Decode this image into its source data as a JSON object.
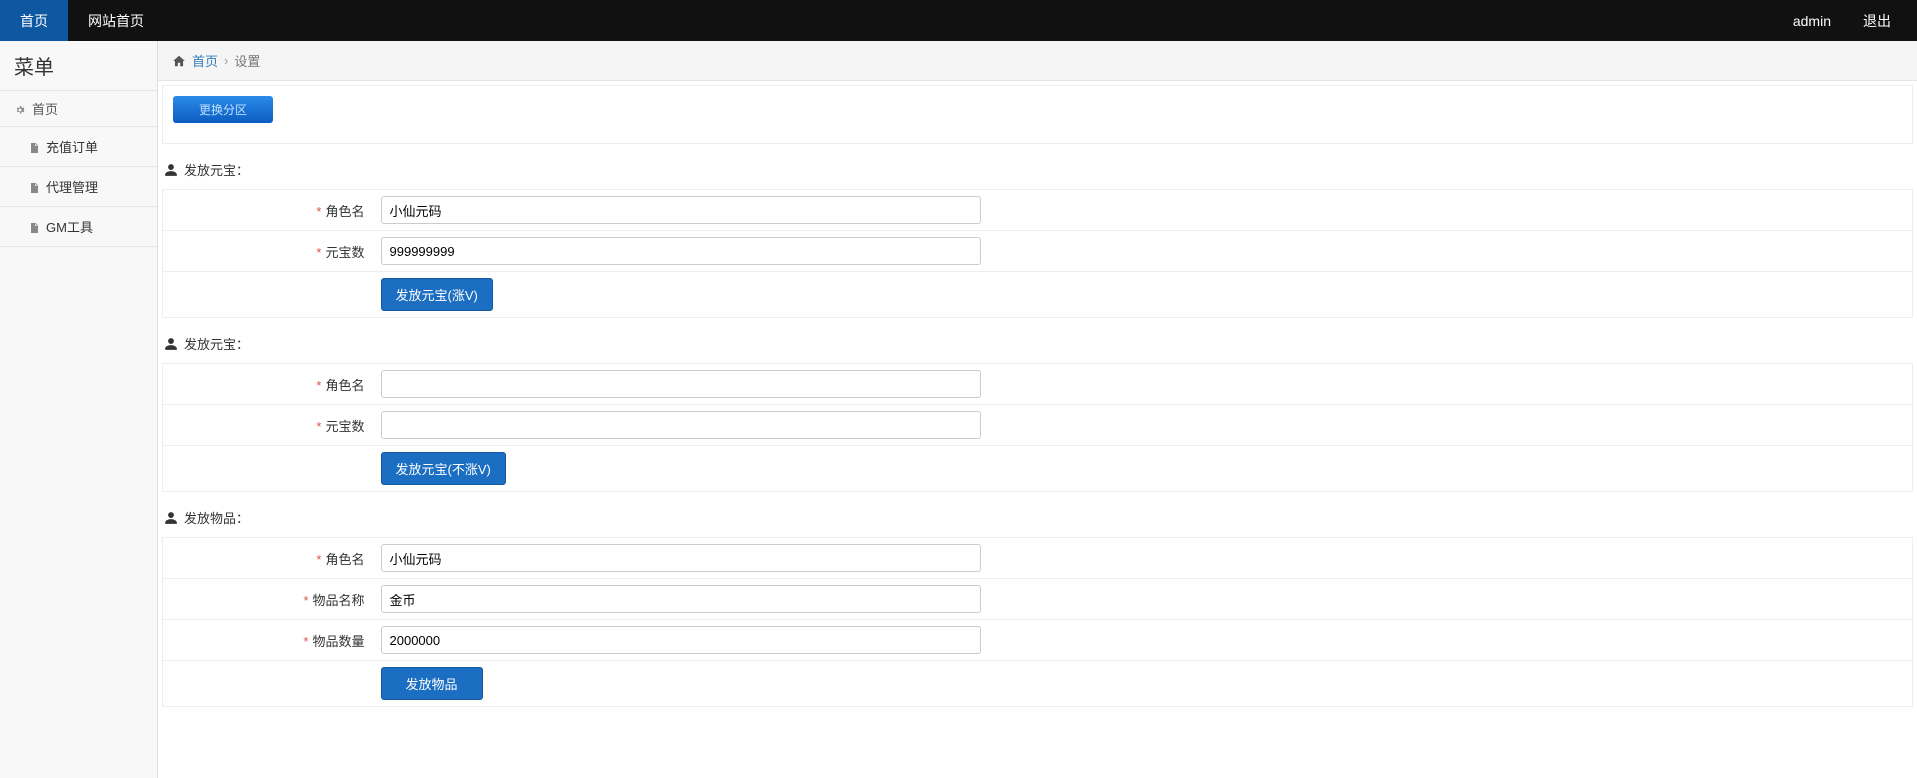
{
  "topbar": {
    "home": "首页",
    "site_home": "网站首页",
    "user": "admin",
    "logout": "退出"
  },
  "sidebar": {
    "title": "菜单",
    "head": "首页",
    "items": [
      {
        "label": "充值订单"
      },
      {
        "label": "代理管理"
      },
      {
        "label": "GM工具"
      }
    ]
  },
  "breadcrumb": {
    "home": "首页",
    "current": "设置"
  },
  "panel": {
    "change_zone": "更换分区"
  },
  "sections": {
    "s1": {
      "title": "发放元宝：",
      "role_label": "角色名",
      "role_value": "小仙元码",
      "amount_label": "元宝数",
      "amount_value": "999999999",
      "submit": "发放元宝(涨V)"
    },
    "s2": {
      "title": "发放元宝：",
      "role_label": "角色名",
      "role_value": "",
      "amount_label": "元宝数",
      "amount_value": "",
      "submit": "发放元宝(不涨V)"
    },
    "s3": {
      "title": "发放物品：",
      "role_label": "角色名",
      "role_value": "小仙元码",
      "item_label": "物品名称",
      "item_value": "金币",
      "qty_label": "物品数量",
      "qty_value": "2000000",
      "submit": "发放物品"
    }
  }
}
